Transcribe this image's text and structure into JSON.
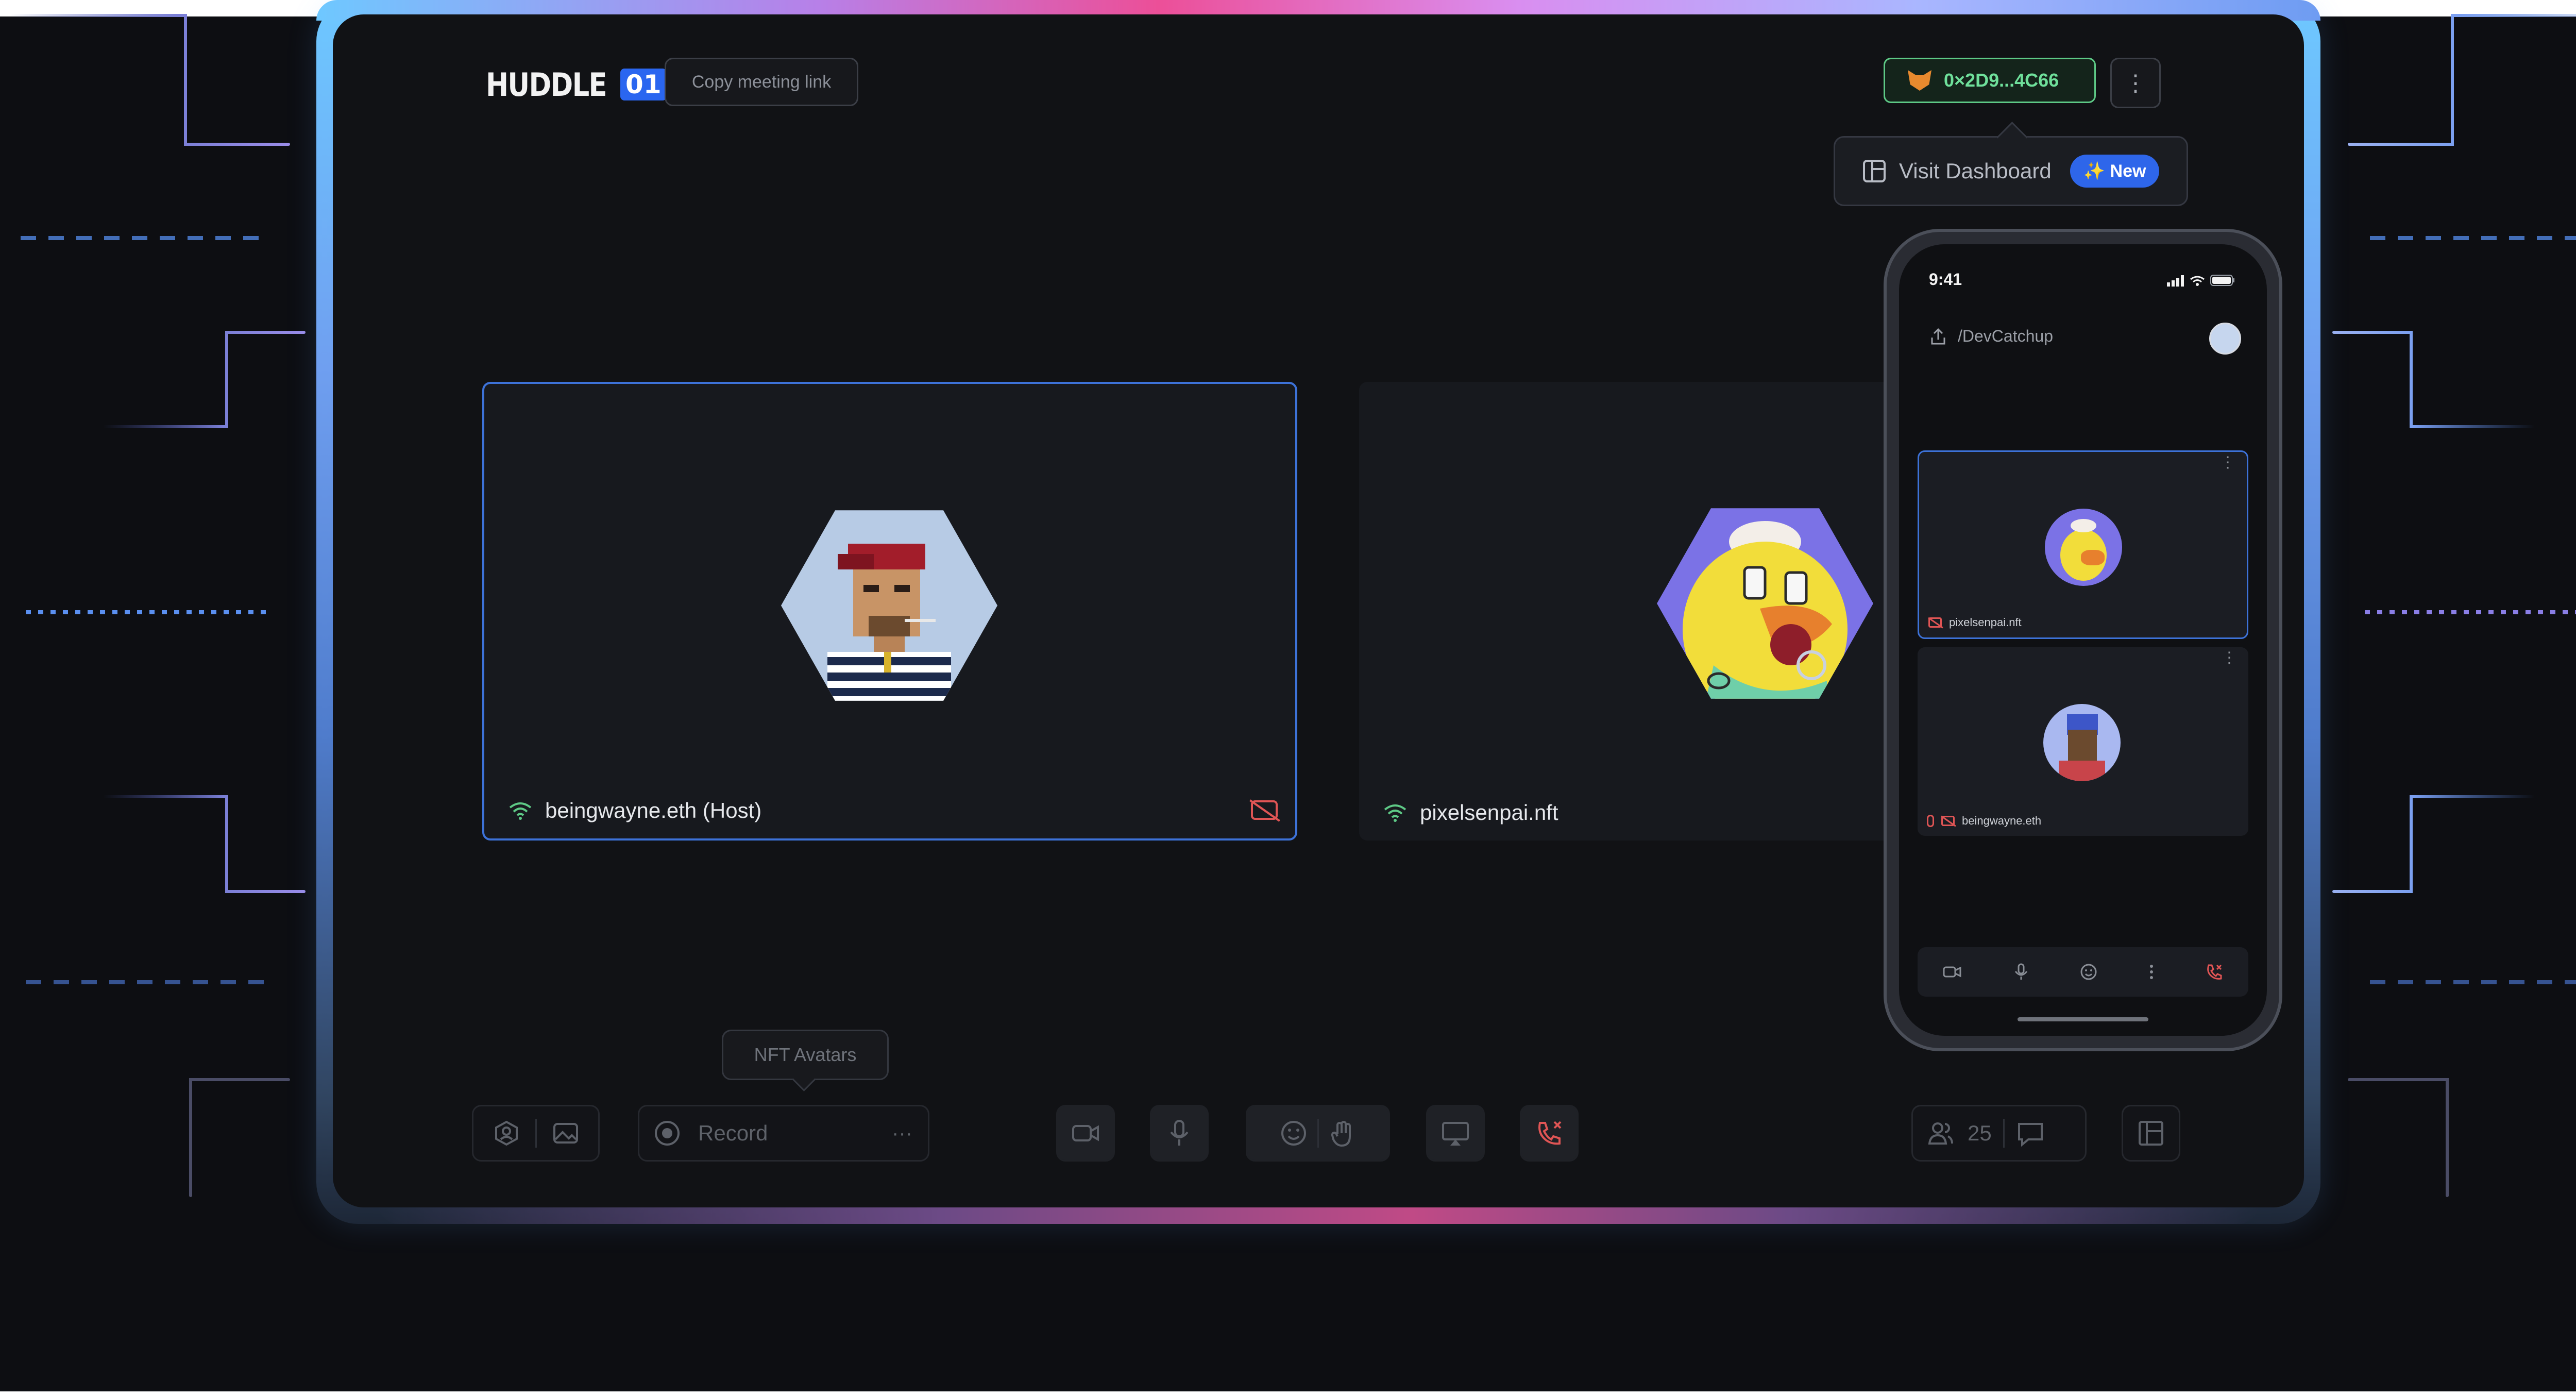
{
  "app": {
    "logo_word": "HUDDLE",
    "logo_badge": "01"
  },
  "header": {
    "copy_link_label": "Copy meeting link",
    "wallet_address": "0×2D9...4C66",
    "more_label": "⋮",
    "dashboard_label": "Visit Dashboard",
    "dashboard_badge": "✨ New"
  },
  "tiles": [
    {
      "name": "beingwayne.eth (Host)",
      "camera_off": true,
      "active": true
    },
    {
      "name": "pixelsenpai.nft",
      "camera_off": false,
      "active": false
    }
  ],
  "controls": {
    "tooltip": "NFT Avatars",
    "record_label": "Record",
    "record_more": "···",
    "participants_count": "25"
  },
  "phone": {
    "time": "9:41",
    "room": "/DevCatchup",
    "tiles": [
      {
        "name": "pixelsenpai.nft"
      },
      {
        "name": "beingwayne.eth"
      }
    ]
  },
  "colors": {
    "accent_blue": "#3d72d8",
    "wallet_green": "#5ec986",
    "danger_red": "#e05555",
    "background": "#111215"
  }
}
